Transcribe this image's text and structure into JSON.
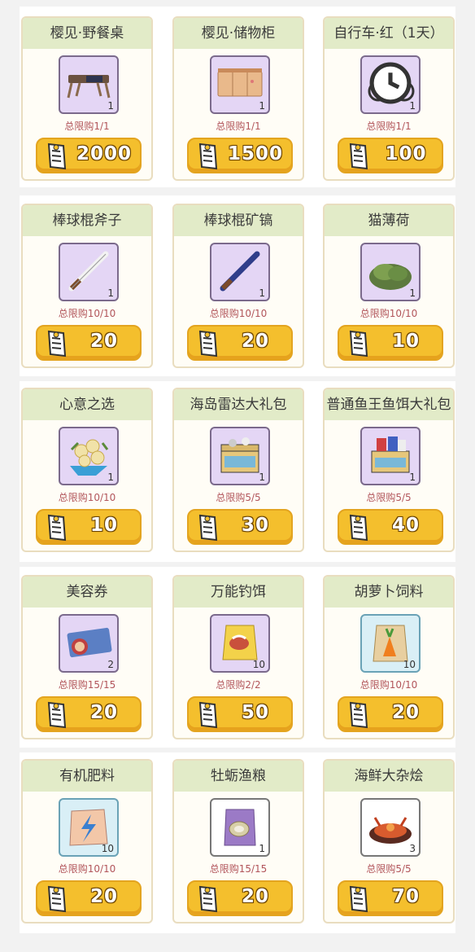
{
  "rows": [
    {
      "items": [
        {
          "name": "樱见·野餐桌",
          "qty": "1",
          "limit": "总限购1/1",
          "price": "2000",
          "icon": "picnic-table-icon",
          "bg": "purple"
        },
        {
          "name": "樱见·储物柜",
          "qty": "1",
          "limit": "总限购1/1",
          "price": "1500",
          "icon": "storage-cabinet-icon",
          "bg": "purple"
        },
        {
          "name": "自行车·红（1天）",
          "qty": "1",
          "limit": "总限购1/1",
          "price": "100",
          "icon": "bicycle-icon",
          "bg": "purple",
          "timed": true
        }
      ]
    },
    {
      "items": [
        {
          "name": "棒球棍斧子",
          "qty": "1",
          "limit": "总限购10/10",
          "price": "20",
          "icon": "baseball-bat-axe-icon",
          "bg": "purple"
        },
        {
          "name": "棒球棍矿镐",
          "qty": "1",
          "limit": "总限购10/10",
          "price": "20",
          "icon": "baseball-bat-pickaxe-icon",
          "bg": "purple"
        },
        {
          "name": "猫薄荷",
          "qty": "1",
          "limit": "总限购10/10",
          "price": "10",
          "icon": "catnip-icon",
          "bg": "purple"
        }
      ]
    },
    {
      "items": [
        {
          "name": "心意之选",
          "qty": "1",
          "limit": "总限购10/10",
          "price": "10",
          "icon": "flower-bouquet-icon",
          "bg": "purple"
        },
        {
          "name": "海岛雷达大礼包",
          "qty": "1",
          "limit": "总限购5/5",
          "price": "30",
          "icon": "gift-box-icon",
          "bg": "purple"
        },
        {
          "name": "普通鱼王鱼饵大礼包",
          "qty": "1",
          "limit": "总限购5/5",
          "price": "40",
          "icon": "bait-gift-box-icon",
          "bg": "purple"
        }
      ]
    },
    {
      "items": [
        {
          "name": "美容券",
          "qty": "2",
          "limit": "总限购15/15",
          "price": "20",
          "icon": "beauty-coupon-icon",
          "bg": "purple"
        },
        {
          "name": "万能钓饵",
          "qty": "10",
          "limit": "总限购2/2",
          "price": "50",
          "icon": "bait-bag-icon",
          "bg": "purple"
        },
        {
          "name": "胡萝卜饲料",
          "qty": "10",
          "limit": "总限购10/10",
          "price": "20",
          "icon": "carrot-feed-icon",
          "bg": "blue"
        }
      ]
    },
    {
      "items": [
        {
          "name": "有机肥料",
          "qty": "10",
          "limit": "总限购10/10",
          "price": "20",
          "icon": "fertilizer-bag-icon",
          "bg": "blue"
        },
        {
          "name": "牡蛎渔粮",
          "qty": "1",
          "limit": "总限购15/15",
          "price": "20",
          "icon": "oyster-feed-icon",
          "bg": "white"
        },
        {
          "name": "海鲜大杂烩",
          "qty": "3",
          "limit": "总限购5/5",
          "price": "70",
          "icon": "seafood-dish-icon",
          "bg": "white"
        }
      ]
    }
  ]
}
